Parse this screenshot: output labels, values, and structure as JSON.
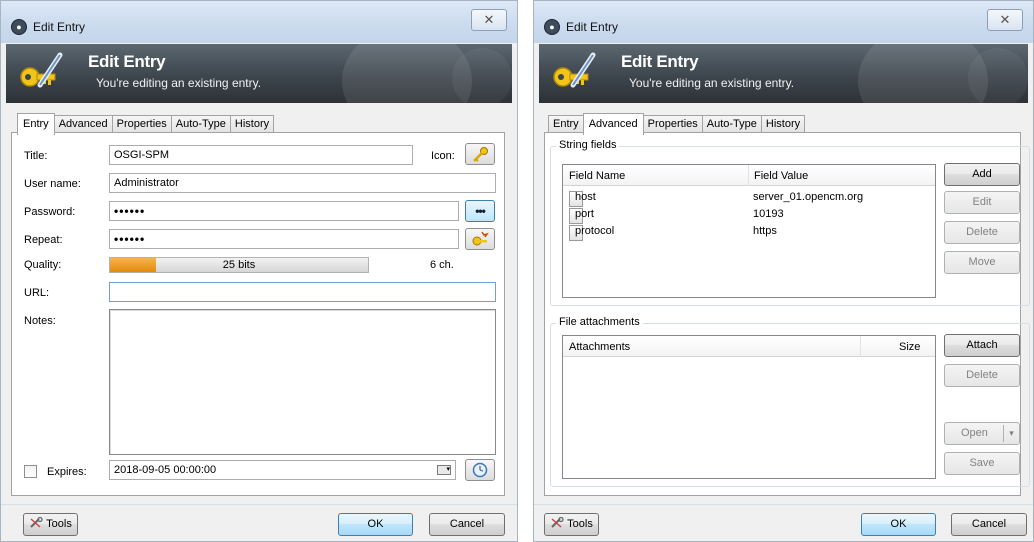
{
  "window_title": "Edit Entry",
  "banner": {
    "title": "Edit Entry",
    "subtitle": "You're editing an existing entry."
  },
  "tabs": [
    "Entry",
    "Advanced",
    "Properties",
    "Auto-Type",
    "History"
  ],
  "entry_tab": {
    "title_label": "Title:",
    "title_value": "OSGI-SPM",
    "icon_label": "Icon:",
    "username_label": "User name:",
    "username_value": "Administrator",
    "password_label": "Password:",
    "password_value": "••••••",
    "repeat_label": "Repeat:",
    "repeat_value": "••••••",
    "show_password_glyph": "•••",
    "quality_label": "Quality:",
    "quality_text": "25 bits",
    "quality_fraction": 0.18,
    "quality_chars": "6 ch.",
    "url_label": "URL:",
    "url_value": "",
    "notes_label": "Notes:",
    "expires_label": "Expires:",
    "expires_checked": false,
    "expires_value": "2018-09-05 00:00:00"
  },
  "advanced_tab": {
    "string_fields_title": "String fields",
    "columns": [
      "Field Name",
      "Field Value"
    ],
    "rows": [
      {
        "name": "host",
        "value": "server_01.opencm.org"
      },
      {
        "name": "port",
        "value": "10193"
      },
      {
        "name": "protocol",
        "value": "https"
      }
    ],
    "buttons": {
      "add": "Add",
      "edit": "Edit",
      "delete": "Delete",
      "move": "Move"
    },
    "attachments_title": "File attachments",
    "attachment_columns": [
      "Attachments",
      "Size"
    ],
    "attachment_buttons": {
      "attach": "Attach",
      "delete": "Delete",
      "open": "Open",
      "save": "Save"
    }
  },
  "footer": {
    "tools": "Tools",
    "ok": "OK",
    "cancel": "Cancel"
  },
  "icons": {
    "window": "lock-icon",
    "banner": "key-pen-icon",
    "entry_icon": "key-icon",
    "generate": "password-generator-icon",
    "calendar": "calendar-icon",
    "clock": "clock-icon",
    "tools": "wrench-icon",
    "close": "close-icon"
  },
  "colors": {
    "banner_dark": "#3d454d",
    "quality_orange": "#e58b08",
    "default_button": "#bee6fd"
  }
}
